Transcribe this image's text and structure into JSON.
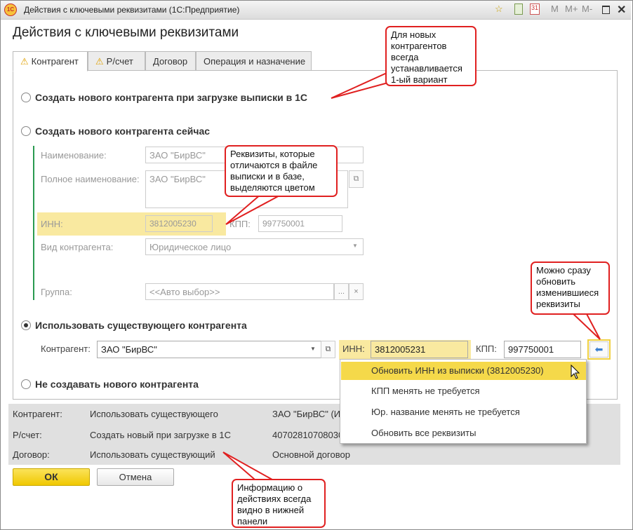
{
  "window": {
    "title": "Действия с ключевыми реквизитами  (1С:Предприятие)",
    "logo": "1С",
    "toolbar": [
      "star-icon",
      "calculator-icon",
      "calendar-icon",
      "M",
      "M+",
      "M-",
      "maximize-icon",
      "close-icon"
    ],
    "calendar_day": "31"
  },
  "heading": "Действия с ключевыми реквизитами",
  "tabs": [
    {
      "label": "Контрагент",
      "warning": true
    },
    {
      "label": "Р/счет",
      "warning": true
    },
    {
      "label": "Договор"
    },
    {
      "label": "Операция и назначение"
    }
  ],
  "options": {
    "create_on_load": "Создать нового контрагента при загрузке выписки в 1С",
    "create_now": "Создать нового контрагента сейчас",
    "use_existing": "Использовать существующего контрагента",
    "dont_create": "Не создавать нового контрагента"
  },
  "new_form": {
    "name_label": "Наименование:",
    "name": "ЗАО \"БирВС\"",
    "full_label": "Полное наименование:",
    "full": "ЗАО \"БирВС\"",
    "inn_label": "ИНН:",
    "inn": "3812005230",
    "kpp_label": "КПП:",
    "kpp": "997750001",
    "kind_label": "Вид контрагента:",
    "kind": "Юридическое лицо",
    "group_label": "Группа:",
    "group": "<<Авто выбор>>"
  },
  "existing": {
    "label": "Контрагент:",
    "value": "ЗАО \"БирВС\"",
    "inn_label": "ИНН:",
    "inn": "3812005231",
    "kpp_label": "КПП:",
    "kpp": "997750001"
  },
  "menu": [
    "Обновить ИНН из выписки (3812005230)",
    "КПП менять не требуется",
    "Юр. название менять не требуется",
    "Обновить все реквизиты"
  ],
  "summary": [
    {
      "k": "Контрагент:",
      "action": "Использовать существующего",
      "object": "ЗАО \"БирВС\" (И"
    },
    {
      "k": "Р/счет:",
      "action": "Создать новый при загрузке в 1С",
      "object": "40702810708030"
    },
    {
      "k": "Договор:",
      "action": "Использовать существующий",
      "object": "Основной договор"
    }
  ],
  "buttons": {
    "ok": "ОК",
    "cancel": "Отмена"
  },
  "callouts": [
    "Для новых контрагентов всегда устанавливается 1-ый вариант",
    "Реквизиты, которые отличаются в файле выписки и в базе, выделяются цветом",
    "Можно сразу обновить изменившиеся реквизиты",
    "Информацию о действиях всегда видно в нижней панели"
  ]
}
